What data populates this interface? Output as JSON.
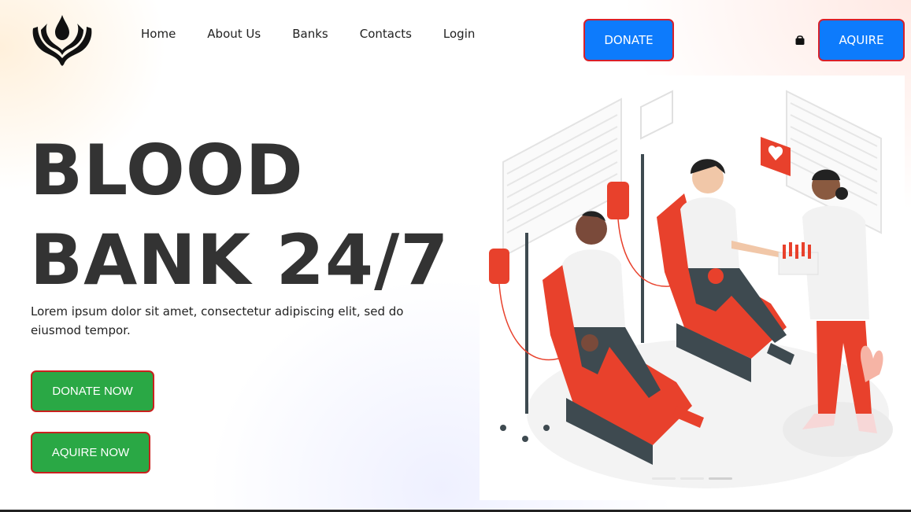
{
  "nav": {
    "items": [
      {
        "label": "Home"
      },
      {
        "label": "About Us"
      },
      {
        "label": "Banks"
      },
      {
        "label": "Contacts"
      },
      {
        "label": "Login"
      }
    ]
  },
  "header": {
    "donate_label": "DONATE",
    "aquire_label": "AQUIRE",
    "cart_icon": "shopping-bag-icon"
  },
  "hero": {
    "title_line1": "BLOOD",
    "title_line2": "BANK 24/7",
    "description": "Lorem ipsum dolor sit amet, consectetur adipiscing elit, sed do eiusmod tempor.",
    "donate_now_label": "DONATE NOW",
    "aquire_now_label": "AQUIRE NOW"
  },
  "colors": {
    "primary_blue": "#0d7bfc",
    "button_green": "#2aa845",
    "border_red": "#d8202a",
    "text_dark": "#333333"
  },
  "carousel": {
    "slide_count": 3,
    "active_index": 2
  }
}
